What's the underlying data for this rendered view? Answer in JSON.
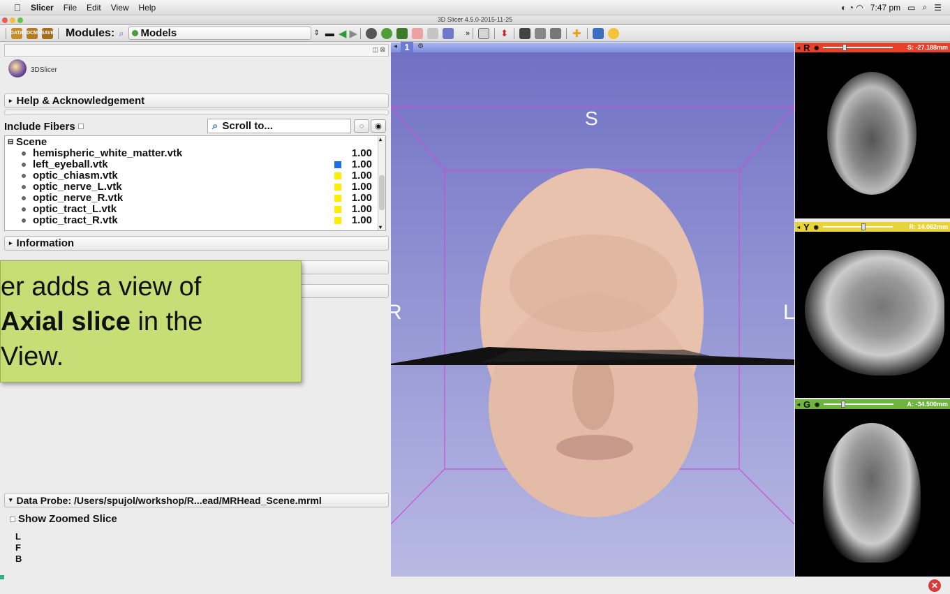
{
  "menubar": {
    "app_name": "Slicer",
    "items": [
      "File",
      "Edit",
      "View",
      "Help"
    ],
    "clock": "7:47 pm"
  },
  "window": {
    "title": "3D Slicer 4.5.0-2015-11-25"
  },
  "toolbar": {
    "data_label": "DATA",
    "dcm_label": "DCM",
    "save_label": "SAVE",
    "modules_label": "Modules:",
    "module_selected": "Models"
  },
  "left_panel": {
    "logo_text": "3DSlicer",
    "help_section": "Help & Acknowledgement",
    "include_fibers_label": "Include Fibers",
    "scroll_placeholder": "Scroll to...",
    "scene_label": "Scene",
    "models": [
      {
        "name": "hemispheric_white_matter.vtk",
        "opacity": "1.00",
        "color": ""
      },
      {
        "name": "left_eyeball.vtk",
        "opacity": "1.00",
        "color": "#1a6fe6"
      },
      {
        "name": "optic_chiasm.vtk",
        "opacity": "1.00",
        "color": "#ffee00"
      },
      {
        "name": "optic_nerve_L.vtk",
        "opacity": "1.00",
        "color": "#ffee00"
      },
      {
        "name": "optic_nerve_R.vtk",
        "opacity": "1.00",
        "color": "#ffee00"
      },
      {
        "name": "optic_tract_L.vtk",
        "opacity": "1.00",
        "color": "#ffee00"
      },
      {
        "name": "optic_tract_R.vtk",
        "opacity": "1.00",
        "color": "#ffee00"
      }
    ],
    "information_section": "Information",
    "data_probe_section": "Data Probe: /Users/spujol/workshop/R...ead/MRHead_Scene.mrml",
    "show_zoomed_slice": "Show Zoomed Slice",
    "probe_letters": [
      "L",
      "F",
      "B"
    ]
  },
  "callout": {
    "line1": "er adds a view of",
    "line2_bold": "Axial slice",
    "line2_rest": " in the",
    "line3": "View."
  },
  "view3d": {
    "number": "1",
    "label_top": "S",
    "label_left": "R",
    "label_right": "L"
  },
  "slice_views": [
    {
      "letter": "R",
      "value": "S: -27.188mm",
      "color": "#e8412a",
      "slider": 0.28
    },
    {
      "letter": "Y",
      "value": "R: 14.062mm",
      "color": "#e8d43a",
      "slider": 0.55
    },
    {
      "letter": "G",
      "value": "A: -34.500mm",
      "color": "#6fb43f",
      "slider": 0.25
    }
  ]
}
